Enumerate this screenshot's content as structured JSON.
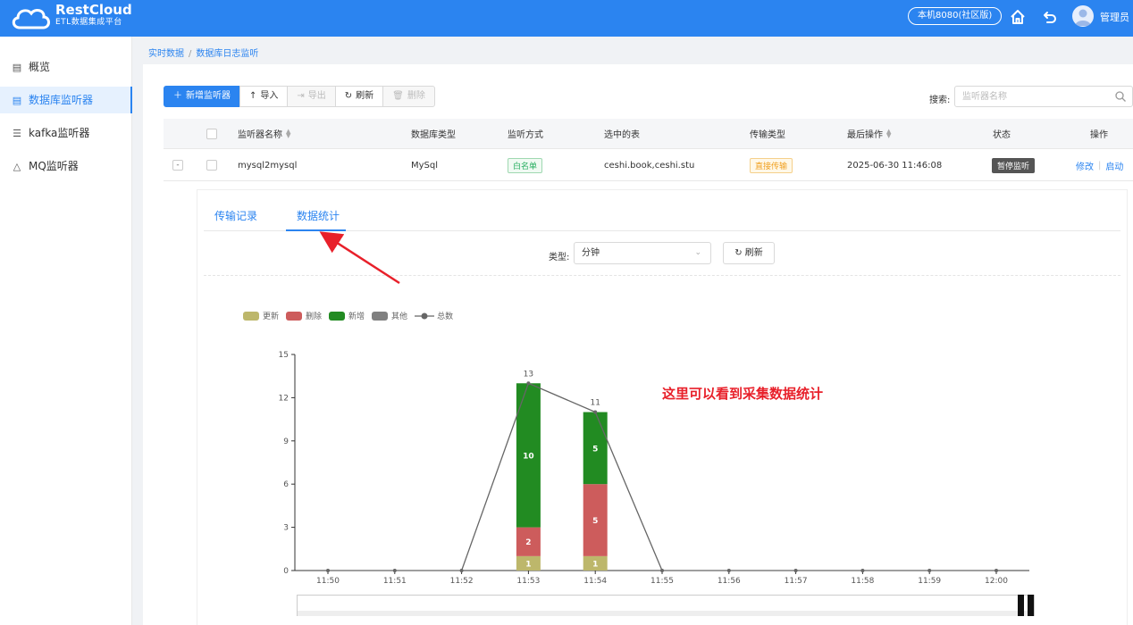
{
  "header": {
    "brand": "RestCloud",
    "brand_sub": "ETL数据集成平台",
    "env_label": "本机8080(社区版)",
    "user_name": "管理员"
  },
  "sidebar": {
    "items": [
      {
        "label": "概览",
        "icon": "chart-icon",
        "active": false
      },
      {
        "label": "数据库监听器",
        "icon": "database-icon",
        "active": true
      },
      {
        "label": "kafka监听器",
        "icon": "kafka-icon",
        "active": false
      },
      {
        "label": "MQ监听器",
        "icon": "mq-icon",
        "active": false
      }
    ]
  },
  "breadcrumb": {
    "root": "实时数据",
    "sep": "/",
    "current": "数据库日志监听"
  },
  "toolbar": {
    "add_label": "新增监听器",
    "import_label": "导入",
    "export_label": "导出",
    "refresh_label": "刷新",
    "delete_label": "删除"
  },
  "search": {
    "label": "搜索:",
    "placeholder": "监听器名称"
  },
  "table": {
    "columns": [
      "监听器名称",
      "数据库类型",
      "监听方式",
      "选中的表",
      "传输类型",
      "最后操作",
      "状态",
      "操作"
    ],
    "rows": [
      {
        "expand": "-",
        "name": "mysql2mysql",
        "db_type": "MySql",
        "listen_mode": "白名单",
        "tables": "ceshi.book,ceshi.stu",
        "transfer_type": "直接传输",
        "last_op": "2025-06-30 11:46:08",
        "status": "暂停监听",
        "action_edit": "修改",
        "action_start": "启动"
      }
    ]
  },
  "detail": {
    "tabs": [
      "传输记录",
      "数据统计"
    ],
    "active_tab": 1,
    "type_label": "类型:",
    "type_value": "分钟",
    "refresh_label": "刷新",
    "annotation": "这里可以看到采集数据统计"
  },
  "colors": {
    "accent": "#2b84f0",
    "update": "#bdb76b",
    "delete": "#cd5c5c",
    "add": "#228b22",
    "other": "#808080",
    "total": "#666666",
    "annotation": "#e8202a"
  },
  "chart_data": {
    "type": "bar",
    "stacked": true,
    "categories": [
      "11:50",
      "11:51",
      "11:52",
      "11:53",
      "11:54",
      "11:55",
      "11:56",
      "11:57",
      "11:58",
      "11:59",
      "12:00"
    ],
    "series": [
      {
        "name": "更新",
        "kind": "bar",
        "values": [
          0,
          0,
          0,
          1,
          1,
          0,
          0,
          0,
          0,
          0,
          0
        ]
      },
      {
        "name": "删除",
        "kind": "bar",
        "values": [
          0,
          0,
          0,
          2,
          5,
          0,
          0,
          0,
          0,
          0,
          0
        ]
      },
      {
        "name": "新增",
        "kind": "bar",
        "values": [
          0,
          0,
          0,
          10,
          5,
          0,
          0,
          0,
          0,
          0,
          0
        ]
      },
      {
        "name": "其他",
        "kind": "bar",
        "values": [
          0,
          0,
          0,
          0,
          0,
          0,
          0,
          0,
          0,
          0,
          0
        ]
      },
      {
        "name": "总数",
        "kind": "line",
        "values": [
          0,
          0,
          0,
          13,
          11,
          0,
          0,
          0,
          0,
          0,
          0
        ]
      }
    ],
    "yticks": [
      0,
      3,
      6,
      9,
      12,
      15
    ],
    "ylim": [
      0,
      15
    ],
    "grid": false,
    "legend_position": "top-left"
  }
}
